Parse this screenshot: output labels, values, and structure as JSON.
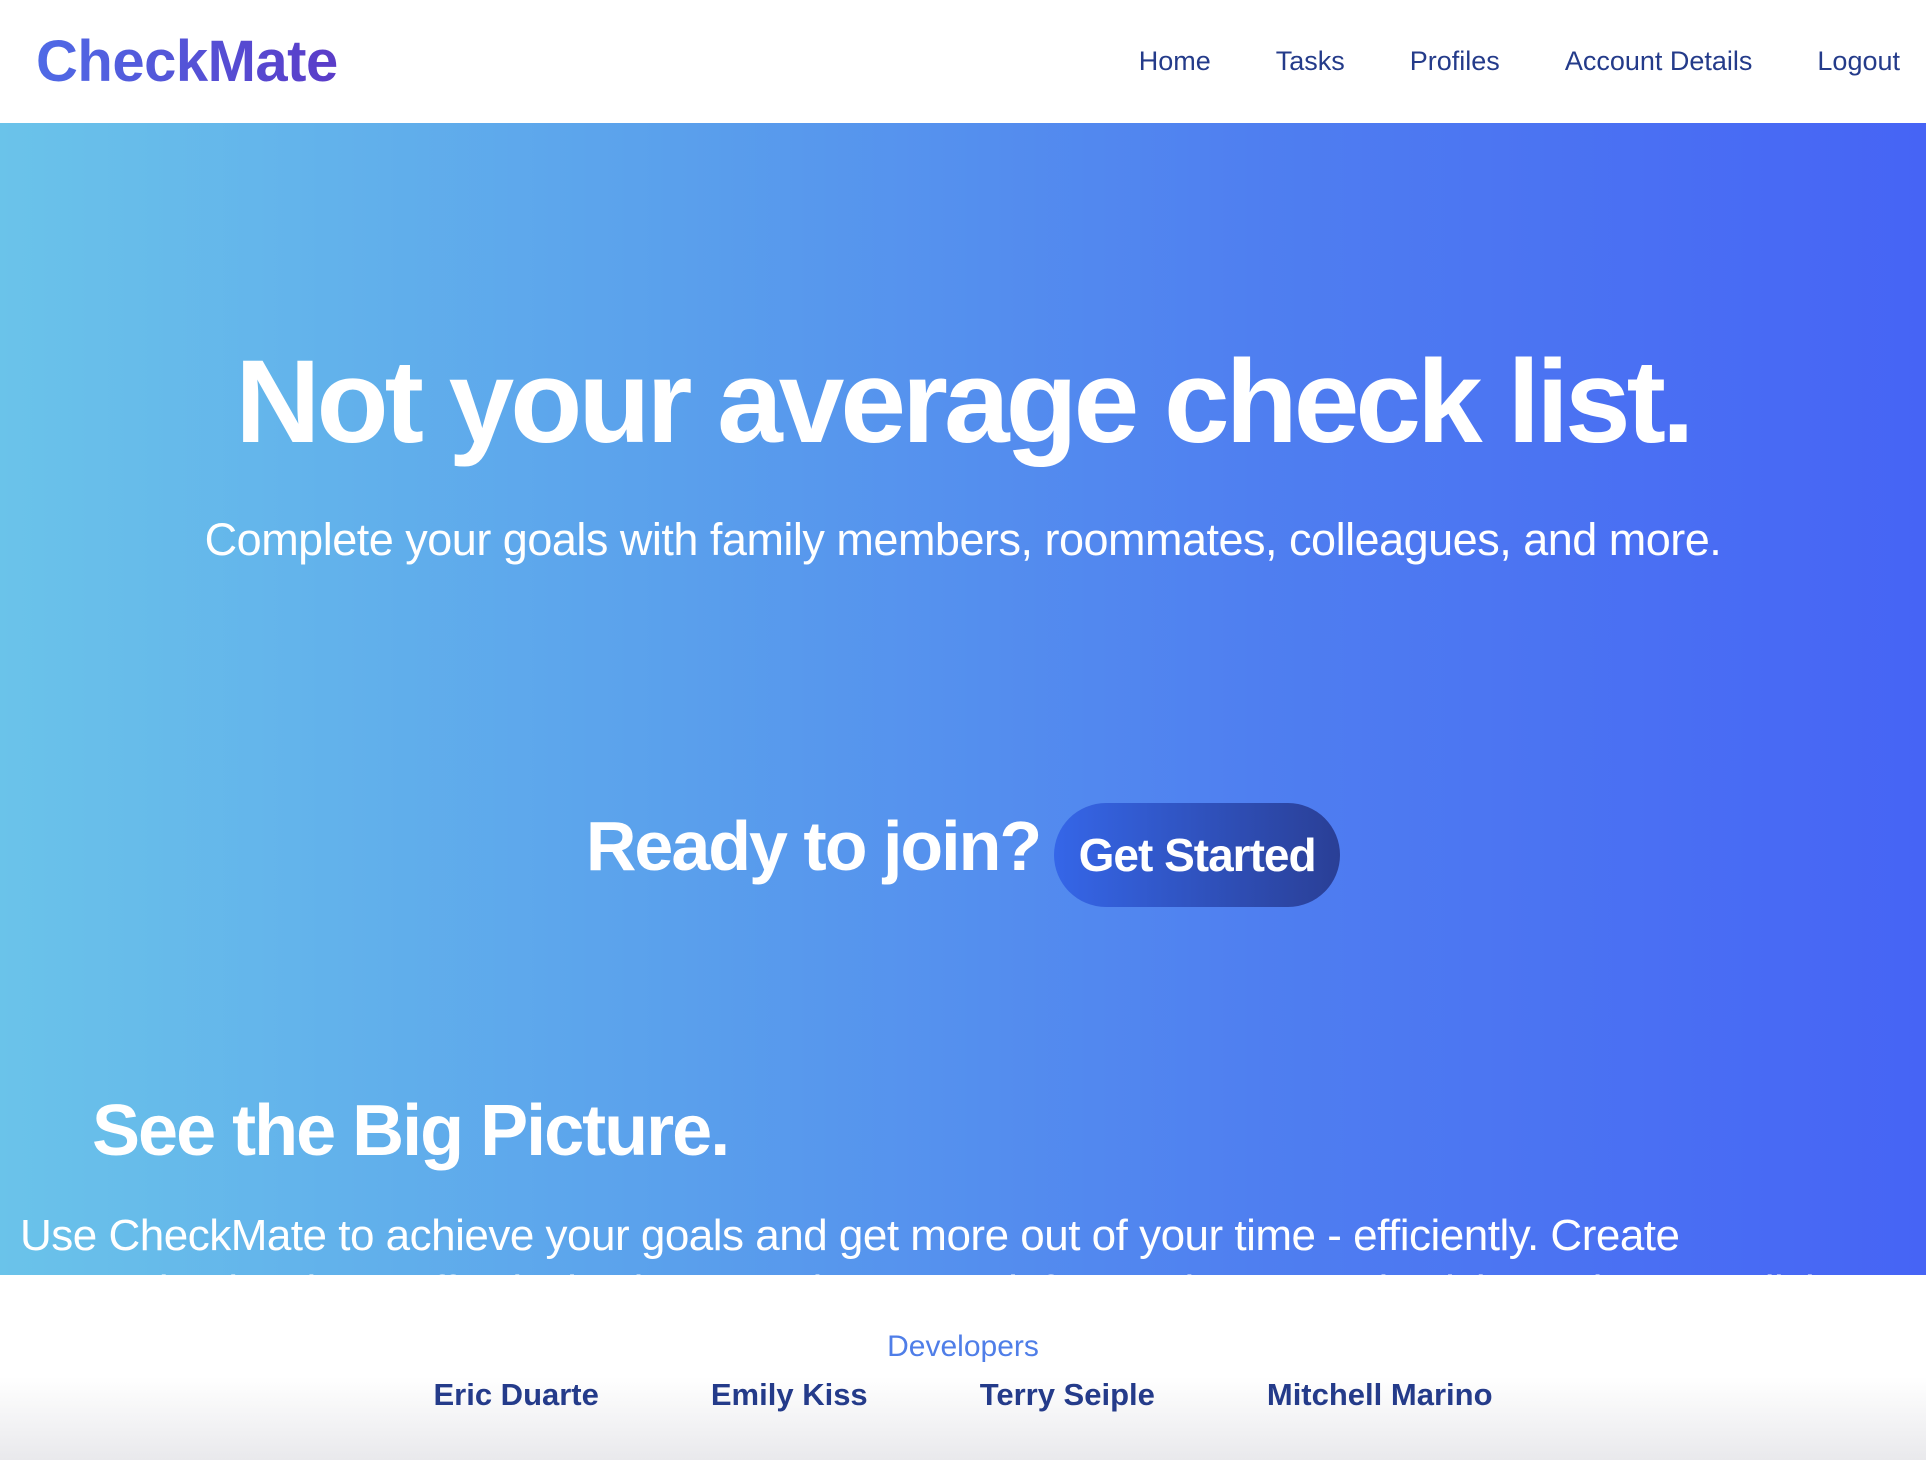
{
  "brand": "CheckMate",
  "nav": {
    "items": [
      {
        "label": "Home"
      },
      {
        "label": "Tasks"
      },
      {
        "label": "Profiles"
      },
      {
        "label": "Account Details"
      },
      {
        "label": "Logout"
      }
    ]
  },
  "hero": {
    "title": "Not your average check list.",
    "subtitle": "Complete your goals with family members, roommates, colleagues, and more.",
    "join_text": "Ready to join?",
    "cta_label": "Get Started"
  },
  "section": {
    "title": "See the Big Picture.",
    "body": "Use CheckMate to achieve your goals and get more out of your time - efficiently. Create customized tasks to effectively plan your day or week for maximum productivity and accomplish"
  },
  "footer": {
    "heading": "Developers",
    "developers": [
      "Eric Duarte",
      "Emily Kiss",
      "Terry Seiple",
      "Mitchell Marino"
    ]
  },
  "colors": {
    "brand_start": "#4f6ae6",
    "brand_end": "#5a3cc8",
    "nav_text": "#243b8a",
    "hero_gradient_start": "#6ac3ea",
    "hero_gradient_end": "#4664f5",
    "cta_start": "#3566e8",
    "cta_end": "#2a3f96",
    "footer_heading": "#4f7ee8"
  }
}
